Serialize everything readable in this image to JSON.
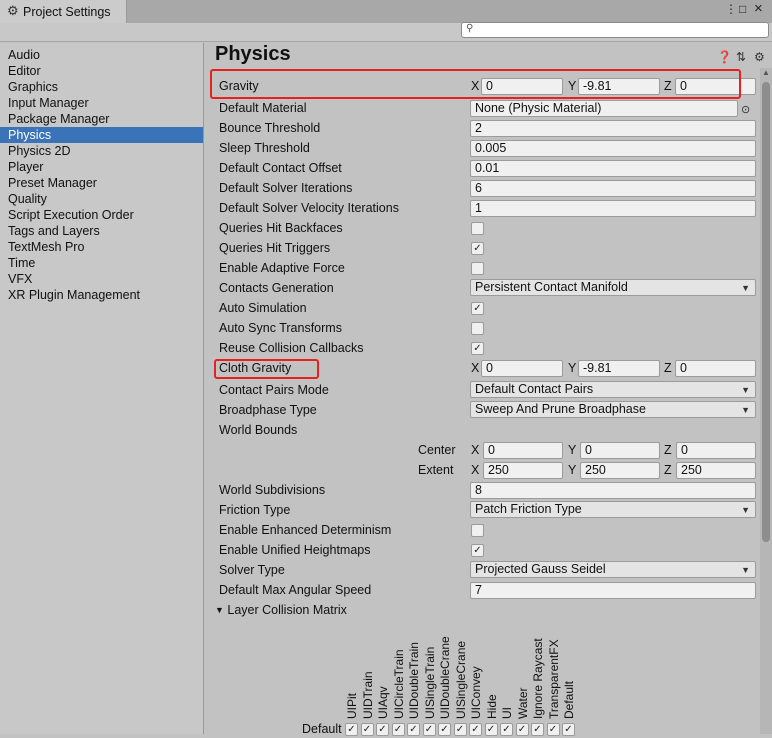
{
  "window": {
    "tab_title": "Project Settings",
    "tab_icon": "gear-icon",
    "menu_glyph": "⋮",
    "maximize_glyph": "□",
    "close_glyph": "×"
  },
  "search": {
    "placeholder": "",
    "icon": "search-icon"
  },
  "sidebar": {
    "items": [
      "Audio",
      "Editor",
      "Graphics",
      "Input Manager",
      "Package Manager",
      "Physics",
      "Physics 2D",
      "Player",
      "Preset Manager",
      "Quality",
      "Script Execution Order",
      "Tags and Layers",
      "TextMesh Pro",
      "Time",
      "VFX",
      "XR Plugin Management"
    ],
    "selected": "Physics"
  },
  "page": {
    "title": "Physics",
    "header_icons": [
      "help-icon",
      "presets-icon",
      "settings-icon"
    ]
  },
  "settings": {
    "gravity": {
      "label": "Gravity",
      "x": "0",
      "y": "-9.81",
      "z": "0"
    },
    "default_material": {
      "label": "Default Material",
      "value": "None (Physic Material)"
    },
    "bounce_threshold": {
      "label": "Bounce Threshold",
      "value": "2"
    },
    "sleep_threshold": {
      "label": "Sleep Threshold",
      "value": "0.005"
    },
    "default_contact_offset": {
      "label": "Default Contact Offset",
      "value": "0.01"
    },
    "default_solver_iterations": {
      "label": "Default Solver Iterations",
      "value": "6"
    },
    "default_solver_velocity_iterations": {
      "label": "Default Solver Velocity Iterations",
      "value": "1"
    },
    "queries_hit_backfaces": {
      "label": "Queries Hit Backfaces",
      "checked": false
    },
    "queries_hit_triggers": {
      "label": "Queries Hit Triggers",
      "checked": true
    },
    "enable_adaptive_force": {
      "label": "Enable Adaptive Force",
      "checked": false
    },
    "contacts_generation": {
      "label": "Contacts Generation",
      "value": "Persistent Contact Manifold"
    },
    "auto_simulation": {
      "label": "Auto Simulation",
      "checked": true
    },
    "auto_sync_transforms": {
      "label": "Auto Sync Transforms",
      "checked": false
    },
    "reuse_collision_callbacks": {
      "label": "Reuse Collision Callbacks",
      "checked": true
    },
    "cloth_gravity": {
      "label": "Cloth Gravity",
      "x": "0",
      "y": "-9.81",
      "z": "0"
    },
    "contact_pairs_mode": {
      "label": "Contact Pairs Mode",
      "value": "Default Contact Pairs"
    },
    "broadphase_type": {
      "label": "Broadphase Type",
      "value": "Sweep And Prune Broadphase"
    },
    "world_bounds": {
      "label": "World Bounds",
      "center_label": "Center",
      "center": {
        "x": "0",
        "y": "0",
        "z": "0"
      },
      "extent_label": "Extent",
      "extent": {
        "x": "250",
        "y": "250",
        "z": "250"
      }
    },
    "world_subdivisions": {
      "label": "World Subdivisions",
      "value": "8"
    },
    "friction_type": {
      "label": "Friction Type",
      "value": "Patch Friction Type"
    },
    "enable_enhanced_determinism": {
      "label": "Enable Enhanced Determinism",
      "checked": false
    },
    "enable_unified_heightmaps": {
      "label": "Enable Unified Heightmaps",
      "checked": true
    },
    "solver_type": {
      "label": "Solver Type",
      "value": "Projected Gauss Seidel"
    },
    "default_max_angular_speed": {
      "label": "Default Max Angular Speed",
      "value": "7"
    }
  },
  "axes": {
    "x": "X",
    "y": "Y",
    "z": "Z"
  },
  "layer_matrix": {
    "foldout_label": "Layer Collision Matrix",
    "columns": [
      "UIPit",
      "UIDTrain",
      "UIAqv",
      "UICircleTrain",
      "UIDoubleTrain",
      "UISingleTrain",
      "UIDoubleCrane",
      "UISingleCrane",
      "UIConvey",
      "Hide",
      "UI",
      "Water",
      "Ignore Raycast",
      "TransparentFX",
      "Default"
    ],
    "rows": [
      {
        "name": "Default",
        "checks": [
          true,
          true,
          true,
          true,
          true,
          true,
          true,
          true,
          true,
          true,
          true,
          true,
          true,
          true,
          true
        ]
      }
    ]
  },
  "glyphs": {
    "check": "✓",
    "dropdown": "▼",
    "foldout": "▼",
    "object_picker": "⊙",
    "scroll_up": "▲"
  },
  "colors": {
    "highlight_box": "#e8201f",
    "selection": "#3b73b9"
  }
}
